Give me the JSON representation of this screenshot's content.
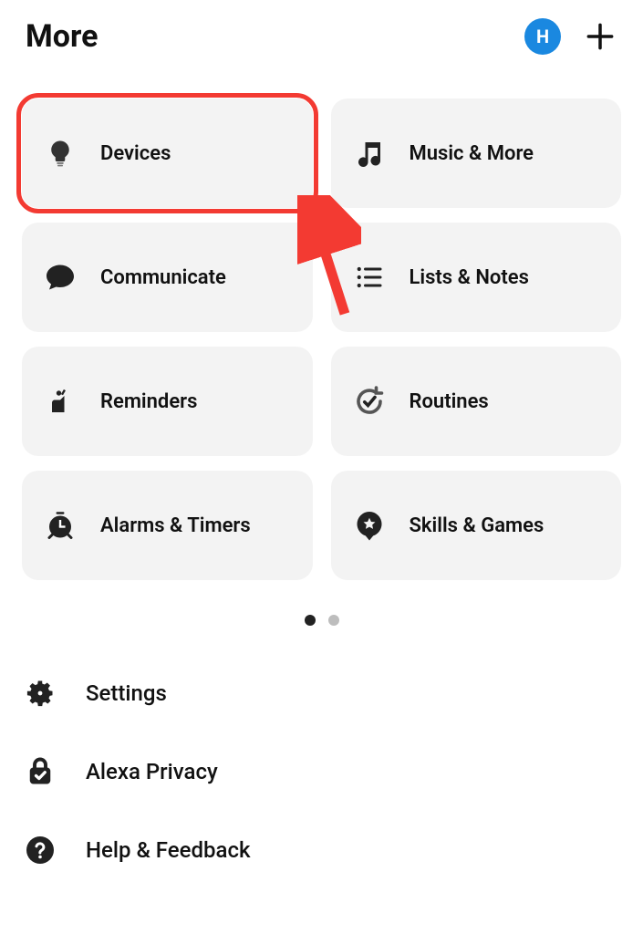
{
  "header": {
    "title": "More",
    "profile_initial": "H"
  },
  "tiles": [
    {
      "label": "Devices"
    },
    {
      "label": "Music & More"
    },
    {
      "label": "Communicate"
    },
    {
      "label": "Lists & Notes"
    },
    {
      "label": "Reminders"
    },
    {
      "label": "Routines"
    },
    {
      "label": "Alarms & Timers"
    },
    {
      "label": "Skills & Games"
    }
  ],
  "pager": {
    "count": 2,
    "active": 0
  },
  "list": [
    {
      "label": "Settings"
    },
    {
      "label": "Alexa Privacy"
    },
    {
      "label": "Help & Feedback"
    }
  ],
  "annotation": {
    "highlight_tile_index": 0
  },
  "colors": {
    "accent": "#1a88e0",
    "highlight": "#f33a32",
    "tile_bg": "#f3f3f3"
  }
}
